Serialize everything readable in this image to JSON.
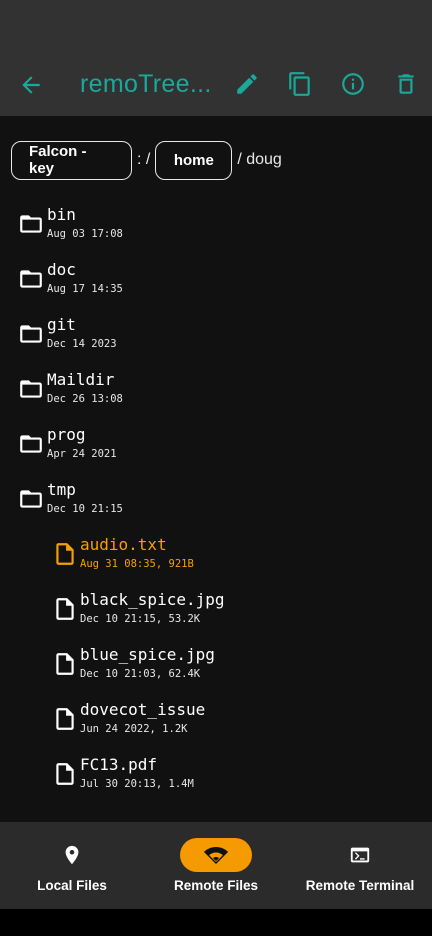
{
  "header": {
    "title": "remoTree...",
    "back_icon": "arrow-left-icon",
    "actions": [
      "edit-icon",
      "copy-icon",
      "info-icon",
      "delete-icon"
    ],
    "accent": "#1aa89a"
  },
  "breadcrumb": {
    "host": "Falcon - key",
    "sep1": ":  /",
    "dir": "home",
    "rest": "/ doug"
  },
  "folders": [
    {
      "name": "bin",
      "meta": "Aug 03 17:08"
    },
    {
      "name": "doc",
      "meta": "Aug 17 14:35"
    },
    {
      "name": "git",
      "meta": "Dec 14  2023"
    },
    {
      "name": "Maildir",
      "meta": "Dec 26 13:08"
    },
    {
      "name": "prog",
      "meta": "Apr 24  2021"
    },
    {
      "name": "tmp",
      "meta": "Dec 10 21:15"
    }
  ],
  "files": [
    {
      "name": "audio.txt",
      "meta": "Aug 31 08:35, 921B",
      "selected": true
    },
    {
      "name": "black_spice.jpg",
      "meta": "Dec 10 21:15, 53.2K"
    },
    {
      "name": "blue_spice.jpg",
      "meta": "Dec 10 21:03, 62.4K"
    },
    {
      "name": "dovecot_issue",
      "meta": "Jun 24  2022, 1.2K"
    },
    {
      "name": "FC13.pdf",
      "meta": "Jul 30 20:13, 1.4M"
    }
  ],
  "nav": {
    "local": "Local Files",
    "remote": "Remote Files",
    "terminal": "Remote Terminal",
    "active": "remote",
    "active_color": "#f59a00"
  }
}
